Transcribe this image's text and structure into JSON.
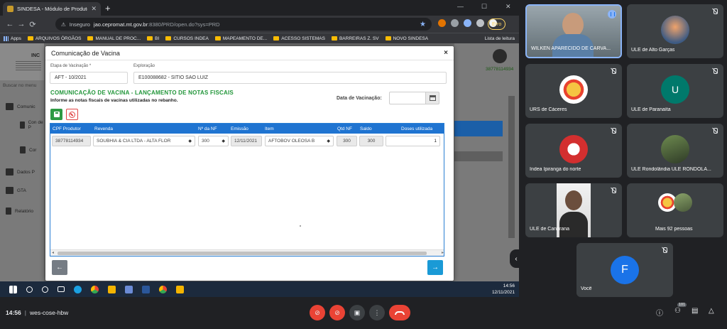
{
  "browser": {
    "tab_title": "SINDESA - Módulo de Produtor",
    "tab_close": "✕",
    "new_tab": "+",
    "win_min": "—",
    "win_max": "☐",
    "win_close": "✕",
    "back": "←",
    "forward": "→",
    "reload": "⟳",
    "security": "Inseguro",
    "url_host": "jao.cepromat.mt.gov.br",
    "url_rest": ":8380/PRD/open.do?sys=PRD",
    "star": "★",
    "error_label": "Erro",
    "bookmarks": [
      "Apps",
      "ARQUIVOS ÓRGÃOS",
      "MANUAL DE PROC...",
      "BI",
      "CURSOS INDEA",
      "MAPEAMENTO DE...",
      "ACESSO SISTEMAS",
      "BARREIRAS Z. SV",
      "NOVO SINDESA"
    ],
    "reading_list": "Lista de leitura"
  },
  "app": {
    "brand": "INC",
    "search_menu": "Buscar no menu",
    "menu": [
      "Comunic",
      "Con\nde P",
      "Cor",
      "Dados P",
      "GTA",
      "Relatório"
    ],
    "user_id": "38778114934"
  },
  "modal": {
    "title": "Comunicação de Vacina",
    "close": "×",
    "etapa_label": "Etapa de Vacinação *",
    "etapa_value": "AFT - 10/2021",
    "exploracao_label": "Exploração",
    "exploracao_value": "E100088682 - SITIO SAO LUIZ",
    "section_title": "COMUNICAÇÃO DE VACINA - LANÇAMENTO DE NOTAS FISCAIS",
    "section_sub": "Informe as notas fiscais de vacinas utilizadas no rebanho.",
    "date_label": "Data de Vacinação:",
    "date_value": "",
    "grid": {
      "columns": [
        "CPF Produtor",
        "Revenda",
        "Nº da NF",
        "Emissão",
        "Item",
        "Qtd NF",
        "Saldo",
        "Doses utilizada"
      ],
      "rows": [
        {
          "cpf": "38778114934",
          "revenda": "SOUBHIA & CIA LTDA - ALTA FLOR",
          "nf": "300",
          "emissao": "12/11/2021",
          "item": "AFTOBOV OLEOSA B",
          "qtd": "300",
          "saldo": "300",
          "doses": "1"
        }
      ]
    },
    "prev": "←",
    "next": "→"
  },
  "taskbar": {
    "time": "14:56",
    "date": "12/11/2021"
  },
  "meet": {
    "participants": [
      {
        "name": "WILKEN APARECIDO DE CARVA..."
      },
      {
        "name": "ULE de Alto Garças"
      },
      {
        "name": "URS de Cáceres"
      },
      {
        "name": "ULE de Paranaíta",
        "initial": "U"
      },
      {
        "name": "Indea Ipiranga do norte"
      },
      {
        "name": "ULE Rondolândia ULE RONDOLA..."
      },
      {
        "name": "ULE de Canarana"
      },
      {
        "name": "Mais 92 pessoas"
      },
      {
        "name": "Você",
        "initial": "F"
      }
    ],
    "time": "14:56",
    "sep": "|",
    "code": "wes-cose-hbw",
    "badge": "101",
    "colors": {
      "red": "#ea4335",
      "blue": "#1a73e8",
      "teal": "#00796b"
    }
  }
}
